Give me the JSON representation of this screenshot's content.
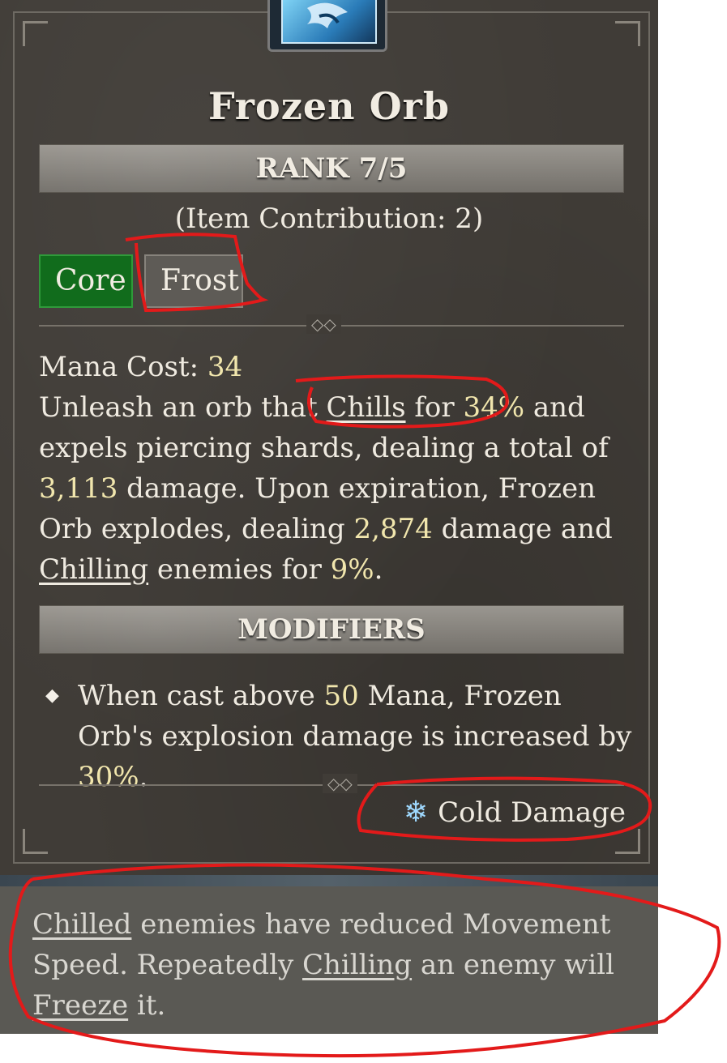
{
  "skill": {
    "title": "Frozen Orb",
    "rank": "RANK 7/5",
    "contribution": "(Item Contribution: 2)",
    "tags": [
      "Core",
      "Frost"
    ]
  },
  "description": {
    "mana_label": "Mana Cost: ",
    "mana_value": "34",
    "p1": "Unleash an orb that ",
    "chills": "Chills",
    "p2": " for ",
    "chill_pct": "34%",
    "p3": " and expels piercing shards, dealing a total of ",
    "damage1": "3,113",
    "p4": " damage. Upon expiration, Frozen Orb explodes, dealing ",
    "damage2": "2,874",
    "p5": " damage and ",
    "chilling": "Chilling",
    "p6": " enemies for ",
    "chill_pct2": "9%",
    "p7": "."
  },
  "modifiers": {
    "header": "MODIFIERS",
    "m1": "When cast above ",
    "mana_threshold": "50",
    "m2": " Mana, Frozen Orb's explosion damage is increased by ",
    "bonus": "30%",
    "m3": "."
  },
  "damage_type": {
    "icon": "snowflake-icon",
    "label": "Cold Damage"
  },
  "tooltip": {
    "chilled": "Chilled",
    "t1": " enemies have reduced Movement Speed. Repeatedly ",
    "chilling": "Chilling",
    "t2": " an enemy will ",
    "freeze": "Freeze",
    "t3": " it."
  },
  "colors": {
    "panel_bg": "#403c37",
    "core_tag": "#116c1c",
    "frost_tag": "#5e5b56",
    "highlight_number": "#f1e6ad",
    "annotation_red": "#e31a1a"
  }
}
